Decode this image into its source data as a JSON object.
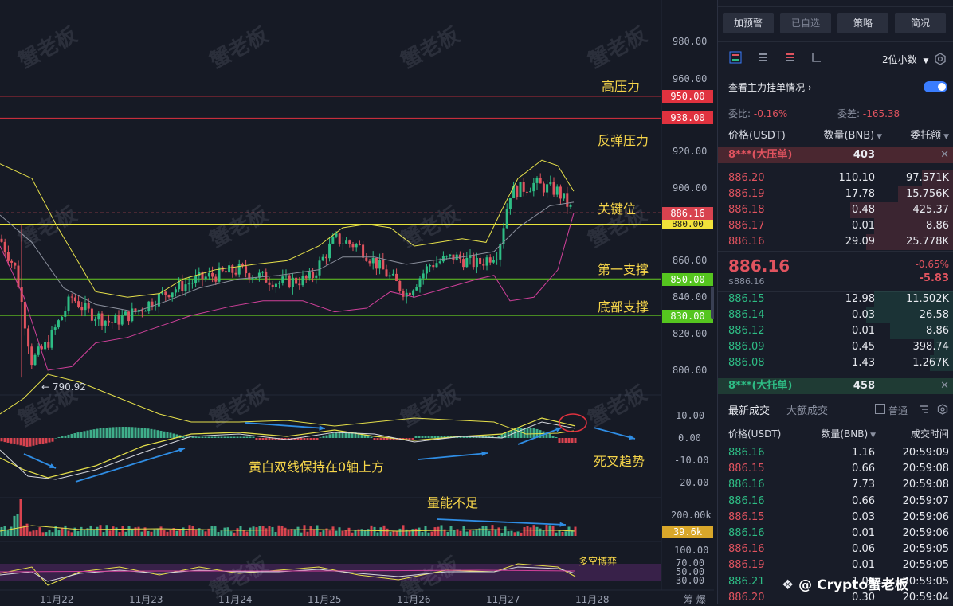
{
  "chart": {
    "watermark": "蟹老板",
    "axis_labels": [
      "980.00",
      "960.00",
      "940.00",
      "920.00",
      "900.00",
      "880.00",
      "860.00",
      "840.00",
      "820.00",
      "800.00"
    ],
    "macd_axis": [
      "10.00",
      "0.00",
      "-10.00",
      "-20.00"
    ],
    "vol_axis": "200.00k",
    "rsi_axis": [
      "100.00",
      "70.00",
      "50.00",
      "30.00"
    ],
    "dates": [
      "11月22",
      "11月23",
      "11月24",
      "11月25",
      "11月26",
      "11月27",
      "11月28"
    ],
    "date_suffix": "筹 爆",
    "price_tags": {
      "p950": "950.00",
      "p938": "938.00",
      "current": "886.16",
      "p880": "880.00",
      "p850": "850.00",
      "p830": "830.00",
      "vol": "39.6k"
    },
    "colors": {
      "resistance": "#e0323f",
      "support": "#66cc22",
      "key": "#e8e43a",
      "price_up": "#2ebd85",
      "price_down": "#e0535f",
      "upper_band": "#e6e04a",
      "lower_band": "#d0409a",
      "mid": "#8a8f9c"
    },
    "low_label": "← 790.92",
    "annotations": {
      "high_pressure": "高压力",
      "rebound_pressure": "反弹压力",
      "key_level": "关键位",
      "first_support": "第一支撑",
      "bottom_support": "底部支撑",
      "dual_lines": "黄白双线保持在0轴上方",
      "death_cross": "死叉趋势",
      "volume_low": "量能不足",
      "bull_bear": "多空博弈"
    },
    "branding": "@ Crypto蟹老板"
  },
  "panel": {
    "buttons": [
      "加预警",
      "已自选",
      "策略",
      "简况"
    ],
    "decimals": "2位小数",
    "main_orders_label": "查看主力挂单情况",
    "ratio_label": "委比:",
    "ratio_value": "-0.16%",
    "diff_label": "委差:",
    "diff_value": "-165.38",
    "headers": {
      "price": "价格(USDT)",
      "qty": "数量(BNB)",
      "total": "委托额"
    },
    "big_ask": {
      "label": "8***(大压单)",
      "value": "403"
    },
    "asks": [
      {
        "price": "886.20",
        "qty": "110.10",
        "total": "97.571K"
      },
      {
        "price": "886.19",
        "qty": "17.78",
        "total": "15.756K"
      },
      {
        "price": "886.18",
        "qty": "0.48",
        "total": "425.37"
      },
      {
        "price": "886.17",
        "qty": "0.01",
        "total": "8.86"
      },
      {
        "price": "886.16",
        "qty": "29.09",
        "total": "25.778K"
      }
    ],
    "last_price": "886.16",
    "last_price_usd": "$886.16",
    "change_pct": "-0.65%",
    "change_abs": "-5.83",
    "bids": [
      {
        "price": "886.15",
        "qty": "12.98",
        "total": "11.502K"
      },
      {
        "price": "886.14",
        "qty": "0.03",
        "total": "26.58"
      },
      {
        "price": "886.12",
        "qty": "0.01",
        "total": "8.86"
      },
      {
        "price": "886.09",
        "qty": "0.45",
        "total": "398.74"
      },
      {
        "price": "886.08",
        "qty": "1.43",
        "total": "1.267K"
      }
    ],
    "big_bid": {
      "label": "8***(大托单)",
      "value": "458"
    },
    "trades_tabs": {
      "latest": "最新成交",
      "large": "大额成交",
      "normal": "普通"
    },
    "trade_headers": {
      "price": "价格(USDT)",
      "qty": "数量(BNB)",
      "time": "成交时间"
    },
    "trades": [
      {
        "price": "886.16",
        "qty": "1.16",
        "time": "20:59:09",
        "side": "buy"
      },
      {
        "price": "886.15",
        "qty": "0.66",
        "time": "20:59:08",
        "side": "sell"
      },
      {
        "price": "886.16",
        "qty": "7.73",
        "time": "20:59:08",
        "side": "buy"
      },
      {
        "price": "886.16",
        "qty": "0.66",
        "time": "20:59:07",
        "side": "buy"
      },
      {
        "price": "886.15",
        "qty": "0.03",
        "time": "20:59:06",
        "side": "sell"
      },
      {
        "price": "886.16",
        "qty": "0.01",
        "time": "20:59:06",
        "side": "buy"
      },
      {
        "price": "886.16",
        "qty": "0.06",
        "time": "20:59:05",
        "side": "sell"
      },
      {
        "price": "886.19",
        "qty": "0.01",
        "time": "20:59:05",
        "side": "sell"
      },
      {
        "price": "886.21",
        "qty": "1.00",
        "time": "20:59:05",
        "side": "buy"
      },
      {
        "price": "886.20",
        "qty": "0.30",
        "time": "20:59:04",
        "side": "sell"
      }
    ]
  }
}
